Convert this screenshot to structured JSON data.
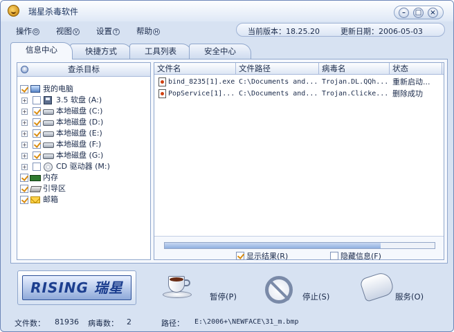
{
  "window": {
    "title": "瑞星杀毒软件"
  },
  "window_controls": {
    "minimize": "–",
    "restore": "□",
    "close": "×"
  },
  "menu": [
    {
      "label": "操作",
      "key": "O"
    },
    {
      "label": "视图",
      "key": "V"
    },
    {
      "label": "设置",
      "key": "T"
    },
    {
      "label": "帮助",
      "key": "H"
    }
  ],
  "version": {
    "label": "当前版本：18.25.20",
    "update": "更新日期：2006-05-03"
  },
  "tabs": [
    "信息中心",
    "快捷方式",
    "工具列表",
    "安全中心"
  ],
  "left_panel": {
    "header": "查杀目标"
  },
  "tree": [
    {
      "label": "我的电脑",
      "icon": "computer-icon",
      "checked": true,
      "expander": false
    },
    {
      "label": "3.5 软盘 (A:)",
      "icon": "floppy-icon",
      "checked": false,
      "expander": true
    },
    {
      "label": "本地磁盘 (C:)",
      "icon": "disk-icon",
      "checked": true,
      "expander": true
    },
    {
      "label": "本地磁盘 (D:)",
      "icon": "disk-icon",
      "checked": true,
      "expander": true
    },
    {
      "label": "本地磁盘 (E:)",
      "icon": "disk-icon",
      "checked": true,
      "expander": true
    },
    {
      "label": "本地磁盘 (F:)",
      "icon": "disk-icon",
      "checked": true,
      "expander": true
    },
    {
      "label": "本地磁盘 (G:)",
      "icon": "disk-icon",
      "checked": true,
      "expander": true
    },
    {
      "label": "CD 驱动器 (M:)",
      "icon": "cd-icon",
      "checked": false,
      "expander": true
    },
    {
      "label": "内存",
      "icon": "memory-icon",
      "checked": true,
      "expander": false
    },
    {
      "label": "引导区",
      "icon": "boot-sector-icon",
      "checked": true,
      "expander": false
    },
    {
      "label": "邮箱",
      "icon": "mailbox-icon",
      "checked": true,
      "expander": false
    }
  ],
  "results": {
    "columns": [
      "文件名",
      "文件路径",
      "病毒名",
      "状态"
    ],
    "rows": [
      {
        "file": "bind_8235[1].exe",
        "path": "C:\\Documents and...",
        "virus": "Trojan.DL.QQh...",
        "status": "重新启动..."
      },
      {
        "file": "PopService[1]...",
        "path": "C:\\Documents and...",
        "virus": "Trojan.Clicke...",
        "status": "删除成功"
      }
    ],
    "progress": 0.8
  },
  "options": {
    "show_results": {
      "label": "显示结果",
      "key": "R",
      "checked": true
    },
    "hide_info": {
      "label": "隐藏信息",
      "key": "F",
      "checked": false
    }
  },
  "logo": {
    "text": "RISING 瑞星"
  },
  "actions": {
    "pause": {
      "label": "暂停",
      "key": "P"
    },
    "stop": {
      "label": "停止",
      "key": "S"
    },
    "service": {
      "label": "服务",
      "key": "O"
    }
  },
  "status": {
    "files_label": "文件数：",
    "files_value": "81936",
    "virus_label": "病毒数：",
    "virus_value": "2",
    "path_label": "路径：",
    "path_value": "E:\\2006+\\NEWFACE\\31_m.bmp"
  },
  "colors": {
    "frame": "#6c86b8",
    "panel": "#f5f8fd",
    "accent_check": "#d98c10"
  }
}
